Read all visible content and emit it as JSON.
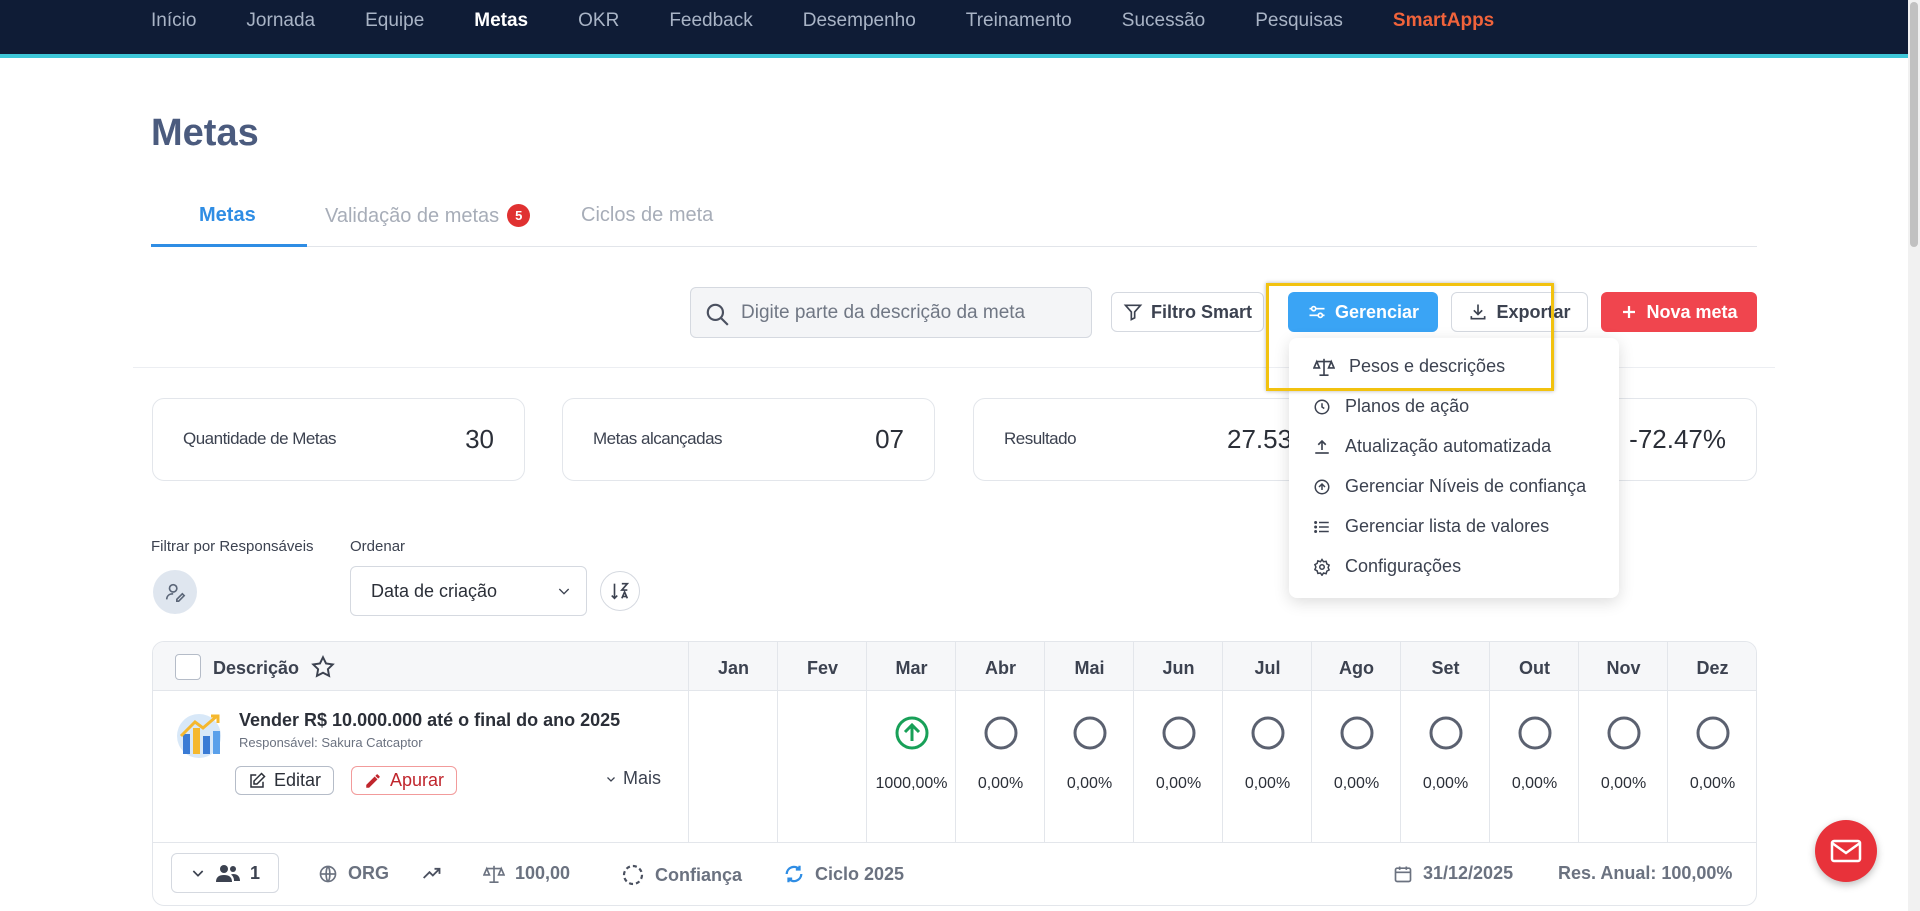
{
  "nav": {
    "items": [
      "Início",
      "Jornada",
      "Equipe",
      "Metas",
      "OKR",
      "Feedback",
      "Desempenho",
      "Treinamento",
      "Sucessão",
      "Pesquisas",
      "SmartApps"
    ],
    "active": "Metas"
  },
  "page": {
    "title": "Metas"
  },
  "tabs": {
    "metas": "Metas",
    "validacao": "Validação de metas",
    "validacao_badge": "5",
    "ciclos": "Ciclos de meta"
  },
  "toolbar": {
    "search_placeholder": "Digite parte da descrição da meta",
    "filtro_smart": "Filtro Smart",
    "gerenciar": "Gerenciar",
    "exportar": "Exportar",
    "nova_meta": "Nova meta"
  },
  "dropdown": {
    "items": [
      "Pesos e descrições",
      "Planos de ação",
      "Atualização automatizada",
      "Gerenciar Níveis de confiança",
      "Gerenciar lista de valores",
      "Configurações"
    ]
  },
  "cards": {
    "quantidade_label": "Quantidade de Metas",
    "quantidade_value": "30",
    "alcancadas_label": "Metas alcançadas",
    "alcancadas_value": "07",
    "resultado_label": "Resultado",
    "resultado_value": "27.53",
    "variacao_value": "-72.47%"
  },
  "filters": {
    "responsaveis_label": "Filtrar por Responsáveis",
    "ordenar_label": "Ordenar",
    "ordenar_value": "Data de criação"
  },
  "table": {
    "desc_header": "Descrição",
    "months": [
      "Jan",
      "Fev",
      "Mar",
      "Abr",
      "Mai",
      "Jun",
      "Jul",
      "Ago",
      "Set",
      "Out",
      "Nov",
      "Dez"
    ],
    "row": {
      "title": "Vender R$ 10.000.000 até o final do ano 2025",
      "responsavel": "Responsável: Sakura Catcaptor",
      "editar": "Editar",
      "apurar": "Apurar",
      "mais": "Mais",
      "values": [
        "",
        "",
        "1000,00%",
        "0,00%",
        "0,00%",
        "0,00%",
        "0,00%",
        "0,00%",
        "0,00%",
        "0,00%",
        "0,00%",
        "0,00%"
      ]
    },
    "footer": {
      "users_count": "1",
      "org": "ORG",
      "peso": "100,00",
      "confianca": "Confiança",
      "ciclo": "Ciclo 2025",
      "data": "31/12/2025",
      "res_anual": "Res. Anual: 100,00%"
    }
  },
  "colors": {
    "topbar": "#0f1c36",
    "accent_line": "#3ec7d8",
    "primary": "#3aa4f5",
    "danger": "#f0454e",
    "success": "#18a058",
    "highlight": "#f2c20f"
  }
}
